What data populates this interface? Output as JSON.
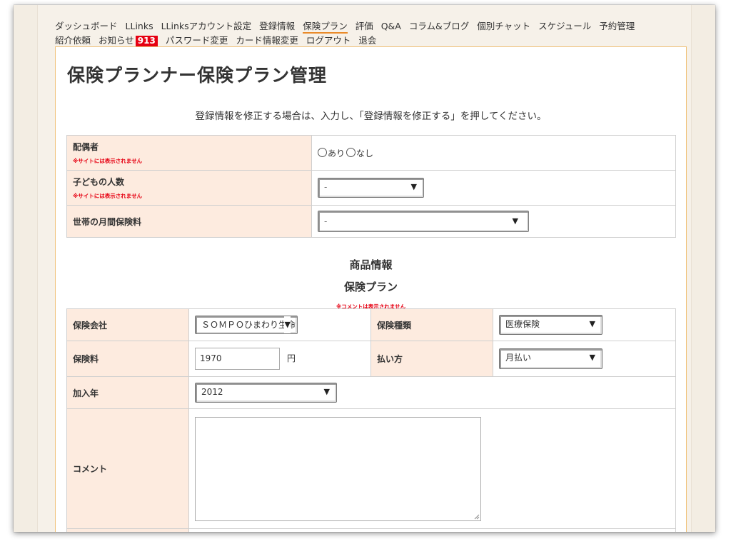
{
  "nav": {
    "row1": [
      {
        "label": "ダッシュボード",
        "active": false
      },
      {
        "label": "LLinks",
        "active": false
      },
      {
        "label": "LLinksアカウント設定",
        "active": false
      },
      {
        "label": "登録情報",
        "active": false
      },
      {
        "label": "保険プラン",
        "active": true
      },
      {
        "label": "評価",
        "active": false
      },
      {
        "label": "Q&A",
        "active": false
      },
      {
        "label": "コラム&ブログ",
        "active": false
      },
      {
        "label": "個別チャット",
        "active": false
      },
      {
        "label": "スケジュール",
        "active": false
      },
      {
        "label": "予約管理",
        "active": false
      }
    ],
    "row2": {
      "referral": "紹介依頼",
      "notice": "お知らせ",
      "notice_count": "913",
      "password": "パスワード変更",
      "card": "カード情報変更",
      "logout": "ログアウト",
      "withdraw": "退会"
    },
    "accent_color": "#e98b2a",
    "badge_color": "#e60012"
  },
  "page": {
    "title": "保険プランナー保険プラン管理",
    "instruction": "登録情報を修正する場合は、入力し、「登録情報を修正する」を押してください。"
  },
  "household": {
    "spouse_label": "配偶者",
    "spouse_note": "※サイトには表示されません",
    "spouse_yes": "あり",
    "spouse_no": "なし",
    "children_label": "子どもの人数",
    "children_note": "※サイトには表示されません",
    "children_value": "-",
    "premium_label": "世帯の月間保険料",
    "premium_value": "-"
  },
  "product": {
    "heading": "商品情報",
    "subheading": "保険プラン",
    "comment_note": "※コメントは表示されません",
    "company_label": "保険会社",
    "company_value": "ＳＯＭＰＯひまわり生命",
    "type_label": "保険種類",
    "type_value": "医療保険",
    "fee_label": "保険料",
    "fee_value": "1970",
    "fee_unit": "円",
    "payment_label": "払い方",
    "payment_value": "月払い",
    "year_label": "加入年",
    "year_value": "2012",
    "comment_label": "コメント",
    "comment_value": ""
  },
  "icons": {
    "dropdown": "▼"
  }
}
